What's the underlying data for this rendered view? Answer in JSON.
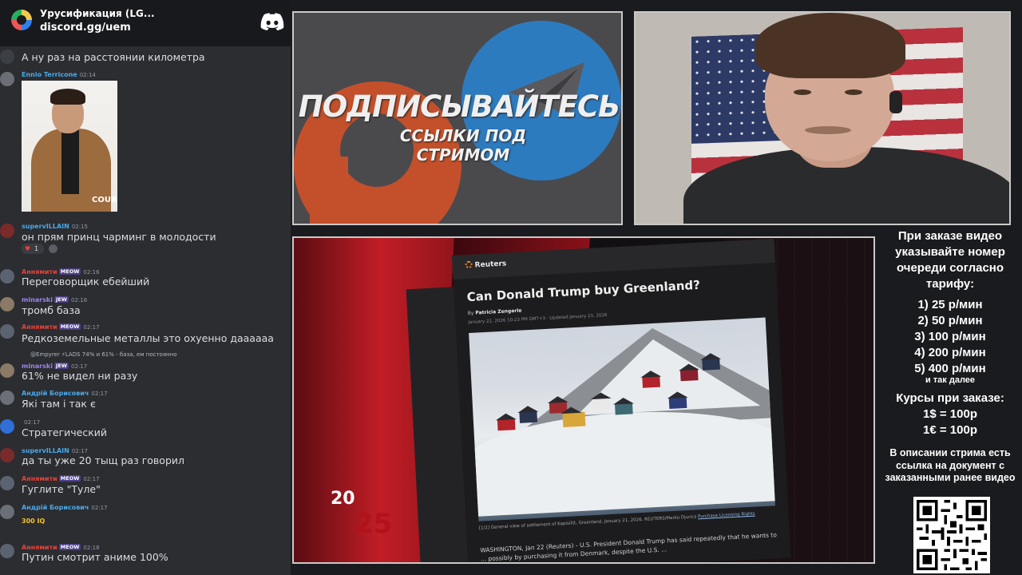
{
  "server": {
    "name": "Урусификация (LG...",
    "invite": "discord.gg/uem"
  },
  "chat": {
    "messages": [
      {
        "author": "",
        "text": "А ну раз на расстоянии километра"
      },
      {
        "author": "Ennio Terricone",
        "time": "02:14",
        "text": "",
        "image_label": "COUB"
      },
      {
        "author": "supervILLAIN",
        "time": "02:15",
        "text": "он прям принц чарминг в молодости",
        "reaction": "1"
      },
      {
        "author": "Аннямити",
        "badge": "MEOW",
        "time": "02:16",
        "text": "Переговорщик ебейший"
      },
      {
        "author": "minarski",
        "badge": "JEW",
        "time": "02:16",
        "text": "тромб база"
      },
      {
        "author": "Аннямити",
        "badge": "MEOW",
        "time": "02:17",
        "text": "Редкоземельные металлы это охуенно даааааа"
      },
      {
        "author": "minarski",
        "badge": "JEW",
        "time": "02:17",
        "text": "61% не видел ни разу",
        "reply": "@Empyrer ⚡LADS 74% и 61% - база, ем постоянно"
      },
      {
        "author": "Андрій Борисович",
        "time": "02:17",
        "text": "Які там і так є"
      },
      {
        "author": "",
        "time": "02:17",
        "text": "Стратегический"
      },
      {
        "author": "supervILLAIN",
        "time": "02:17",
        "text": "да ты уже 20 тыщ раз говорил"
      },
      {
        "author": "Аннямити",
        "badge": "MEOW",
        "time": "02:17",
        "text": "Гуглите \"Туле\""
      },
      {
        "author": "Андрій Борисович",
        "time": "02:17",
        "text": "300 IQ"
      },
      {
        "author": "Аннямити",
        "badge": "MEOW",
        "time": "02:18",
        "text": "Путин смотрит аниме 100%"
      }
    ]
  },
  "promo": {
    "title": "ПОДПИСЫВАЙТЕСЬ",
    "subtitle": "ССЫЛКИ ПОД СТРИМОМ"
  },
  "video": {
    "year_a": "20",
    "year_b": "25",
    "source": "Reuters",
    "headline": "Can Donald Trump buy Greenland?",
    "byline_prefix": "By",
    "byline_author": "Patricia Zengerle",
    "date": "January 22, 2026 10:23 PM GMT+3 · Updated January 23, 2026",
    "caption": "[1/2] General view of settlement of Kapisillit, Greenland, January 21, 2026. REUTERS/Marko Djurica",
    "caption_link": "Purchase Licensing Rights",
    "body": "WASHINGTON, Jan 22 (Reuters) - U.S. President Donald Trump has said repeatedly that he wants to ... possibly by purchasing it from Denmark, despite the U.S. ..."
  },
  "tariff": {
    "intro": "При заказе видео указывайте номер очереди согласно тарифу:",
    "items": [
      "1) 25 р/мин",
      "2) 50 р/мин",
      "3) 100 р/мин",
      "4) 200 р/мин",
      "5) 400 р/мин"
    ],
    "more": "и так далее",
    "courses_heading": "Курсы при заказе:",
    "courses": [
      "1$ = 100р",
      "1€ = 100р"
    ],
    "description": "В описании стрима есть ссылка на документ с заказанными ранее видео"
  },
  "colors": {
    "chat_bg": "#2b2d31",
    "header_bg": "#18191c",
    "name_blue": "#4aa8e8",
    "name_red": "#e8413a",
    "name_purple": "#9b84ee"
  },
  "icons": [
    "discord-icon",
    "server-icon",
    "telegram-icon",
    "boosty-icon"
  ]
}
